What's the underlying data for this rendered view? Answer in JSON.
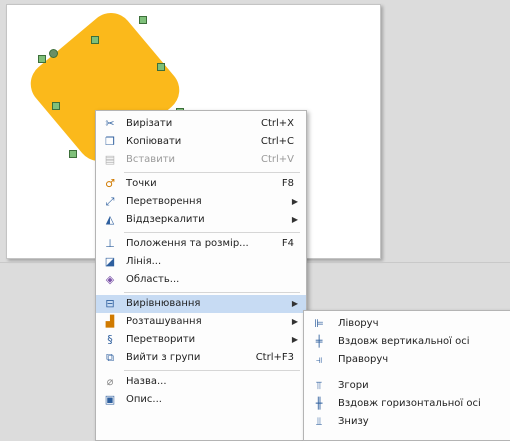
{
  "context_menu": {
    "cut": {
      "label": "Вирізати",
      "shortcut": "Ctrl+X"
    },
    "copy": {
      "label": "Копіювати",
      "shortcut": "Ctrl+C"
    },
    "paste": {
      "label": "Вставити",
      "shortcut": "Ctrl+V"
    },
    "points": {
      "label": "Точки",
      "shortcut": "F8"
    },
    "convert": {
      "label": "Перетворення"
    },
    "flip": {
      "label": "Віддзеркалити"
    },
    "position_size": {
      "label": "Положення та розмір...",
      "shortcut": "F4"
    },
    "line": {
      "label": "Лінія..."
    },
    "area": {
      "label": "Область..."
    },
    "align": {
      "label": "Вирівнювання"
    },
    "arrange": {
      "label": "Розташування"
    },
    "transform": {
      "label": "Перетворити"
    },
    "exit_group": {
      "label": "Вийти з групи",
      "shortcut": "Ctrl+F3"
    },
    "name": {
      "label": "Назва..."
    },
    "description": {
      "label": "Опис..."
    }
  },
  "align_submenu": {
    "left": {
      "label": "Ліворуч"
    },
    "center_vertical": {
      "label": "Вздовж вертикальної осі"
    },
    "right": {
      "label": "Праворуч"
    },
    "top": {
      "label": "Згори"
    },
    "center_horizontal": {
      "label": "Вздовж горизонтальної осі"
    },
    "bottom": {
      "label": "Знизу"
    }
  },
  "colors": {
    "shape_fill": "#fbb91b",
    "highlight": "#c7dbf3",
    "canvas": "#dcdcdc"
  }
}
